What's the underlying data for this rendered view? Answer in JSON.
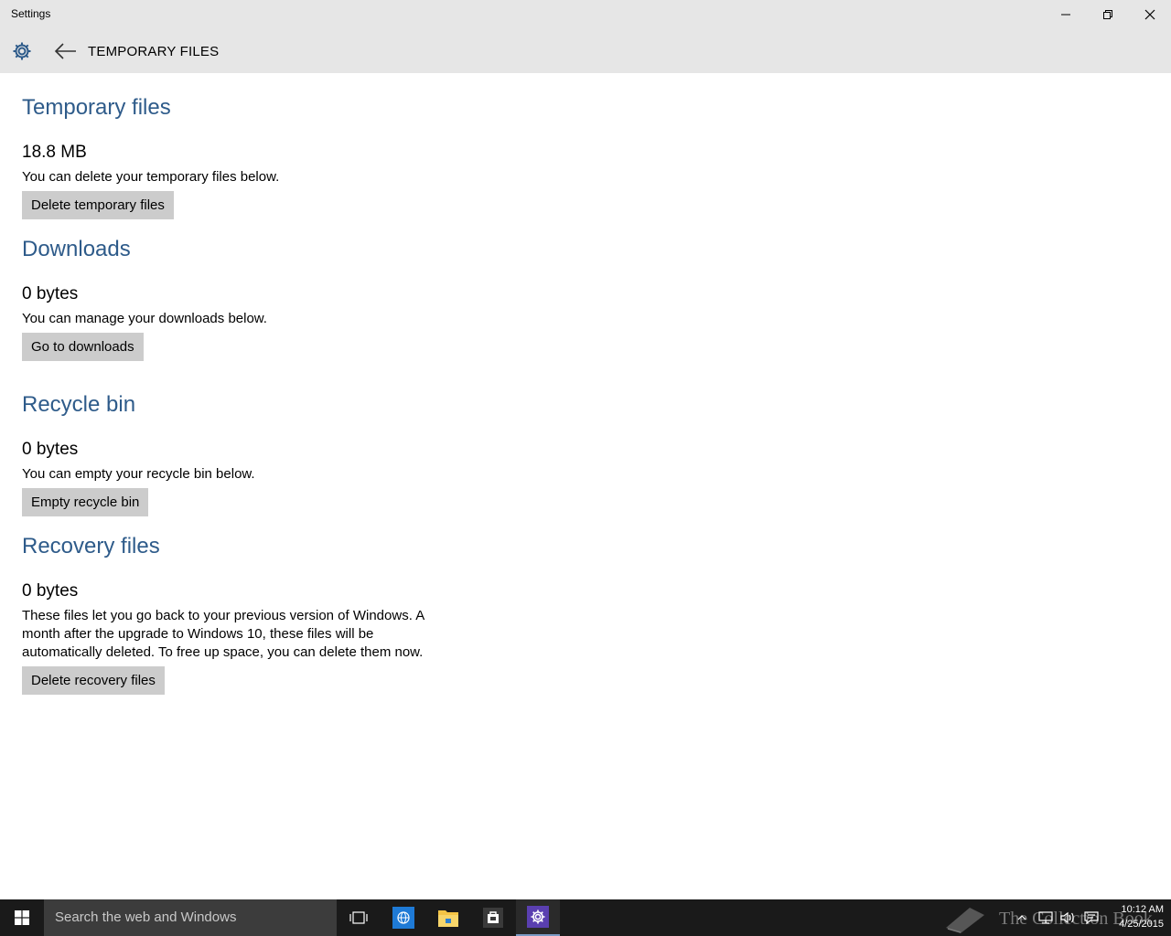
{
  "window": {
    "title": "Settings",
    "controls": {
      "minimize_icon": "minimize-icon",
      "restore_icon": "restore-icon",
      "close_icon": "close-icon"
    }
  },
  "appbar": {
    "settings_icon": "gear-icon",
    "back_icon": "back-arrow-icon",
    "page_title": "TEMPORARY FILES"
  },
  "sections": [
    {
      "title": "Temporary files",
      "size": "18.8 MB",
      "description": "You can delete your temporary files below.",
      "button": "Delete temporary files"
    },
    {
      "title": "Downloads",
      "size": "0 bytes",
      "description": "You can manage your downloads below.",
      "button": "Go to downloads"
    },
    {
      "title": "Recycle bin",
      "size": "0 bytes",
      "description": "You can empty your recycle bin below.",
      "button": "Empty recycle bin"
    },
    {
      "title": "Recovery files",
      "size": "0 bytes",
      "description_lines": [
        "These files let you go back to your previous version of Windows. A",
        "month after the upgrade to Windows 10, these files will be",
        "automatically deleted. To free up space, you can delete them now."
      ],
      "button": "Delete recovery files"
    }
  ],
  "taskbar": {
    "search_placeholder": "Search the web and Windows",
    "apps": [
      "task-view-icon",
      "browser-icon",
      "file-explorer-icon",
      "store-icon",
      "settings-icon"
    ],
    "tray_icons": [
      "chevron-up-icon",
      "network-icon",
      "volume-icon",
      "action-center-icon"
    ],
    "time": "10:12 AM",
    "date": "4/25/2015",
    "watermark": "The Collection Book"
  },
  "colors": {
    "accent_heading": "#2e5b8a",
    "button_bg": "#cccccc",
    "chrome_bg": "#e6e6e6",
    "taskbar_bg": "#1a1a1a",
    "search_bg": "#3c3c3c"
  }
}
